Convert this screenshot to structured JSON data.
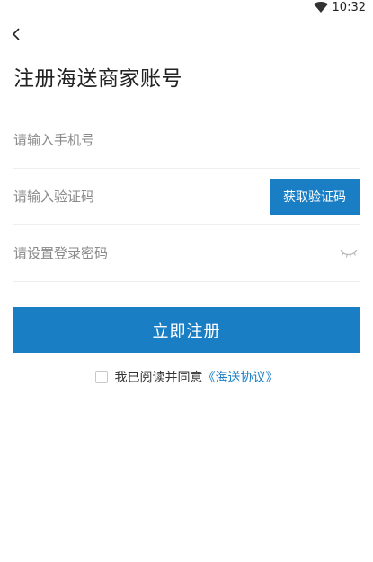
{
  "status_bar": {
    "time": "10:32",
    "wifi_icon": "wifi-icon"
  },
  "nav": {
    "back_icon": "chevron-left-icon"
  },
  "title": "注册海送商家账号",
  "form": {
    "phone": {
      "placeholder": "请输入手机号",
      "value": ""
    },
    "code": {
      "placeholder": "请输入验证码",
      "value": "",
      "button_label": "获取验证码"
    },
    "password": {
      "placeholder": "请设置登录密码",
      "value": "",
      "toggle_icon": "eye-closed-icon"
    }
  },
  "register_button": "立即注册",
  "agreement": {
    "text": "我已阅读并同意",
    "link": "《海送协议》",
    "checked": false
  },
  "colors": {
    "primary": "#1a7ec4",
    "text": "#333333",
    "placeholder": "#8a8a8a",
    "divider": "#eeeeee"
  }
}
